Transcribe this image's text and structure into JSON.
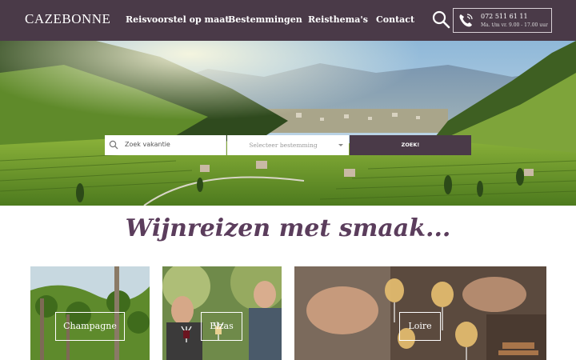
{
  "header": {
    "logo": "CAZEBONNE",
    "nav": [
      "Reisvoorstel op maat",
      "Bestemmingen",
      "Reisthema's",
      "Contact"
    ],
    "phone": {
      "number": "072 511 61 11",
      "hours": "Ma. t/m vr. 9.00 - 17.00 uur"
    }
  },
  "search": {
    "placeholder": "Zoek vakantie",
    "destination_placeholder": "Selecteer bestemming",
    "button_label": "ZOEK!"
  },
  "headline": "Wijnreizen met smaak...",
  "cards": [
    {
      "label": "Champagne"
    },
    {
      "label": "Elzas"
    },
    {
      "label": "Loire"
    }
  ],
  "colors": {
    "brand": "#4a3a48",
    "headline": "#5b3d5c"
  }
}
